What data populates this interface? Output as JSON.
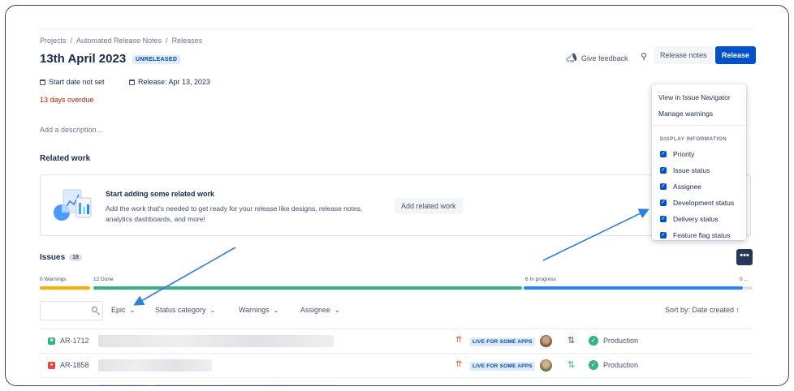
{
  "breadcrumb": [
    "Projects",
    "/",
    "Automated Release Notes",
    "/",
    "Releases"
  ],
  "page": {
    "title": "13th April 2023",
    "status": "UNRELEASED",
    "start_date": "Start date not set",
    "release_date": "Release: Apr 13, 2023",
    "overdue": "13 days overdue",
    "description_placeholder": "Add a description..."
  },
  "header_actions": {
    "feedback": "Give feedback",
    "release_notes": "Release notes",
    "release": "Release"
  },
  "related_work": {
    "heading": "Related work",
    "card_title": "Start adding some related work",
    "card_desc": "Add the work that's needed to get ready for your release like designs, release notes, analytics dashboards, and more!",
    "add_button": "Add related work"
  },
  "menu": {
    "items": [
      "View in Issue Navigator",
      "Manage warnings"
    ],
    "section": "DISPLAY INFORMATION",
    "checks": [
      "Priority",
      "Issue status",
      "Assignee",
      "Development status",
      "Delivery status",
      "Feature flag status"
    ]
  },
  "issues": {
    "heading": "Issues",
    "count": "18",
    "progress": {
      "warnings_label": "0 Warnings",
      "done_label": "12 Done",
      "in_progress_label": "6 In progress",
      "todo_label": "0 ..."
    },
    "filters": [
      "Epic",
      "Status category",
      "Warnings",
      "Assignee"
    ],
    "sort": "Sort by: Date created ↑",
    "rows": [
      {
        "key": "AR-1712",
        "type_color": "#36B37E",
        "badge": "LIVE FOR SOME APPS",
        "environment": "Production"
      },
      {
        "key": "AR-1858",
        "type_color": "#E5493A",
        "badge": "LIVE FOR SOME APPS",
        "environment": "Production"
      }
    ]
  },
  "colors": {
    "brand": "#0052CC",
    "done": "#36B37E",
    "in_progress": "#2684FF",
    "warnings": "#FFAB00",
    "annotation_arrow": "#2F7FD8"
  }
}
